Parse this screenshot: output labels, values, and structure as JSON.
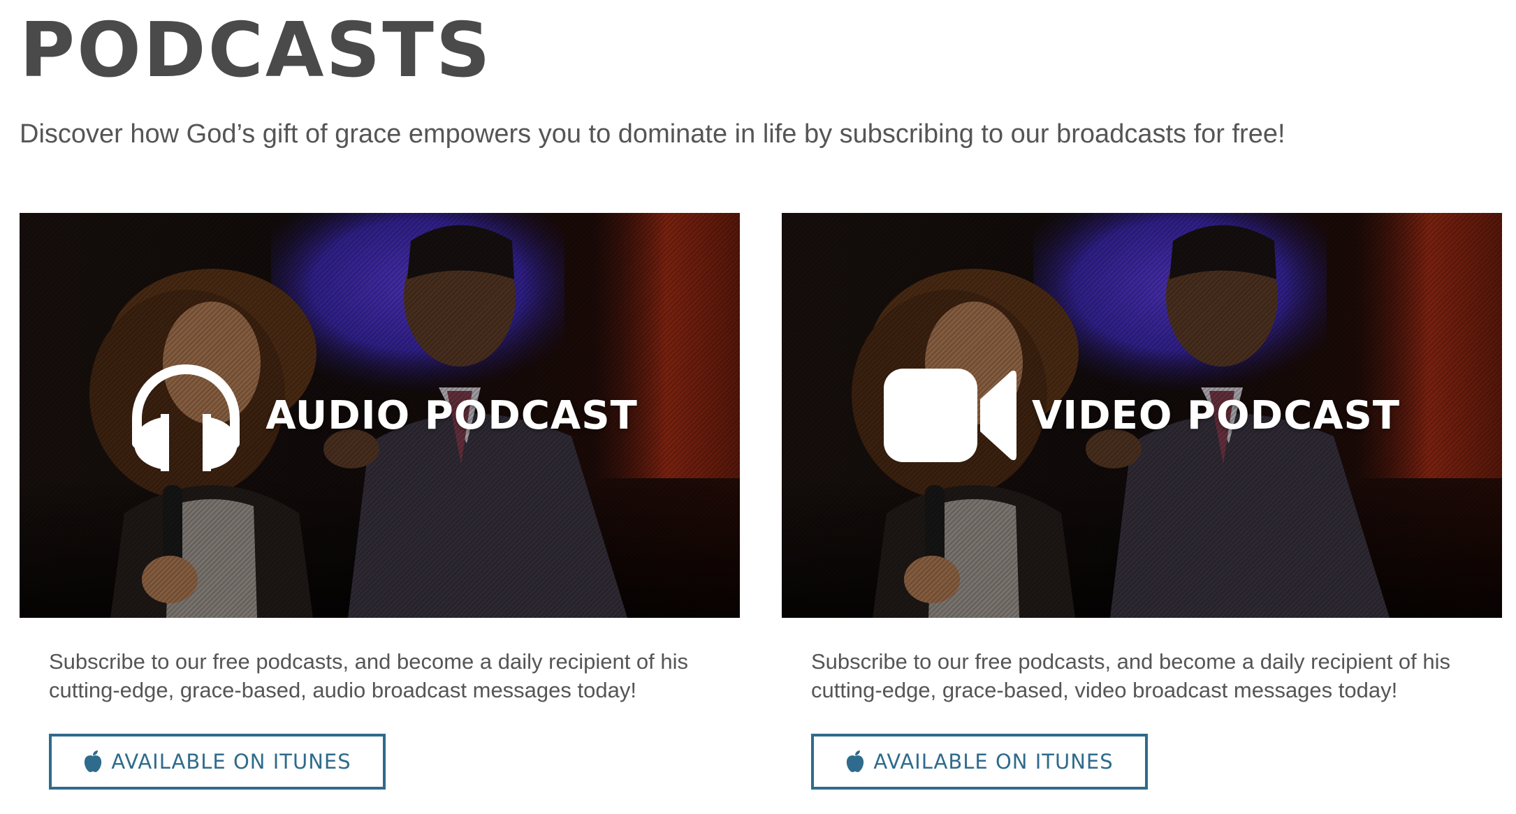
{
  "page": {
    "title": "PODCASTS",
    "intro": "Discover how God’s gift of grace empowers you to dominate in life by subscribing to our broadcasts for free!"
  },
  "cards": [
    {
      "id": "audio",
      "label": "AUDIO PODCAST",
      "icon": "headphones-icon",
      "description": "Subscribe to our free podcasts, and become a daily recipient of his cutting-edge, grace-based, audio broadcast messages today!",
      "button_label": "AVAILABLE ON ITUNES",
      "button_icon": "apple-icon"
    },
    {
      "id": "video",
      "label": "VIDEO PODCAST",
      "icon": "video-camera-icon",
      "description": "Subscribe to our free podcasts, and become a daily recipient of his cutting-edge, grace-based, video broadcast messages today!",
      "button_label": "AVAILABLE ON ITUNES",
      "button_icon": "apple-icon"
    }
  ],
  "colors": {
    "title": "#4a4a4a",
    "body_text": "#555555",
    "button_accent": "#2f6b8c",
    "overlay_text": "#ffffff"
  }
}
